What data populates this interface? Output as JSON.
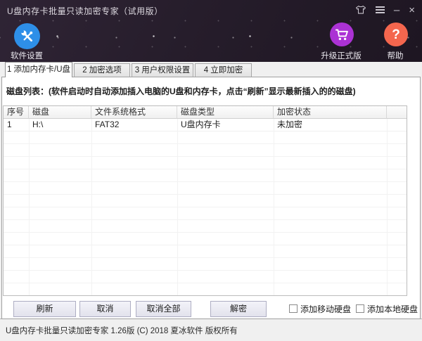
{
  "window": {
    "title": "U盘内存卡批量只读加密专家（试用版）",
    "controls": {
      "minimize": "–",
      "close": "×"
    }
  },
  "toolbar": {
    "settings": {
      "label": "软件设置"
    },
    "upgrade": {
      "label": "升级正式版"
    },
    "help": {
      "label": "帮助",
      "glyph": "?"
    }
  },
  "tabs": [
    {
      "label": "1 添加内存卡/U盘",
      "active": true
    },
    {
      "label": "2 加密选项",
      "active": false
    },
    {
      "label": "3 用户权限设置",
      "active": false
    },
    {
      "label": "4 立即加密",
      "active": false
    }
  ],
  "panel": {
    "caption": "磁盘列表：(软件启动时自动添加插入电脑的U盘和内存卡，点击“刷新”显示最新插入的的磁盘)",
    "table": {
      "columns": [
        "序号",
        "磁盘",
        "文件系统格式",
        "磁盘类型",
        "加密状态",
        ""
      ],
      "rows": [
        [
          "1",
          "H:\\",
          "FAT32",
          "U盘内存卡",
          "未加密"
        ]
      ]
    },
    "buttons": {
      "refresh": "刷新",
      "cancel": "取消",
      "cancel_all": "取消全部",
      "decrypt": "解密"
    },
    "checkboxes": [
      {
        "label": "添加移动硬盘",
        "checked": false
      },
      {
        "label": "添加本地硬盘",
        "checked": false
      }
    ]
  },
  "statusbar": {
    "text": "U盘内存卡批量只读加密专家  1.26版  (C) 2018  夏冰软件  版权所有"
  },
  "colors": {
    "header_bg": "#241b28",
    "settings_blue": "#2e8fe8",
    "upgrade_purple": "#ab32d4",
    "help_coral": "#f4664e"
  }
}
